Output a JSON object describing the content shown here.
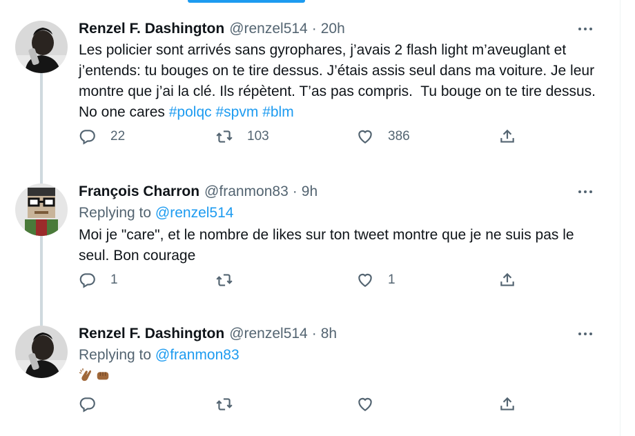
{
  "tweets": [
    {
      "name": "Renzel F. Dashington",
      "handle": "@renzel514",
      "dot": "·",
      "time": "20h",
      "text_plain": "Les policier sont arrivés sans gyrophares, j’avais 2 flash light m’aveuglant et j’entends: tu bouges on te tire dessus. J’étais assis seul dans ma voiture. Je leur montre que j’ai la clé. Ils répètent. T’as pas compris.  Tu bouge on te tire dessus. No one cares ",
      "hashtags": [
        "#polqc",
        "#spvm",
        "#blm"
      ],
      "replies": "22",
      "retweets": "103",
      "likes": "386"
    },
    {
      "name": "François Charron",
      "handle": "@franmon83",
      "dot": "·",
      "time": "9h",
      "replying_prefix": "Replying to ",
      "replying_to": "@renzel514",
      "text_plain": "Moi je \"care\", et le nombre de likes sur ton tweet montre que je ne suis pas le seul. Bon courage",
      "replies": "1",
      "retweets": "",
      "likes": "1"
    },
    {
      "name": "Renzel F. Dashington",
      "handle": "@renzel514",
      "dot": "·",
      "time": "8h",
      "replying_prefix": "Replying to ",
      "replying_to": "@franmon83",
      "emojis": [
        "clapping-hands-emoji",
        "fist-bump-emoji"
      ],
      "replies": "",
      "retweets": "",
      "likes": ""
    }
  ],
  "colors": {
    "accent": "#1d9bf0",
    "secondary_text": "#536471",
    "primary_text": "#0f1419",
    "thread_line": "#cfd9de"
  },
  "icons": [
    "reply-icon",
    "retweet-icon",
    "like-icon",
    "share-icon",
    "more-icon"
  ]
}
